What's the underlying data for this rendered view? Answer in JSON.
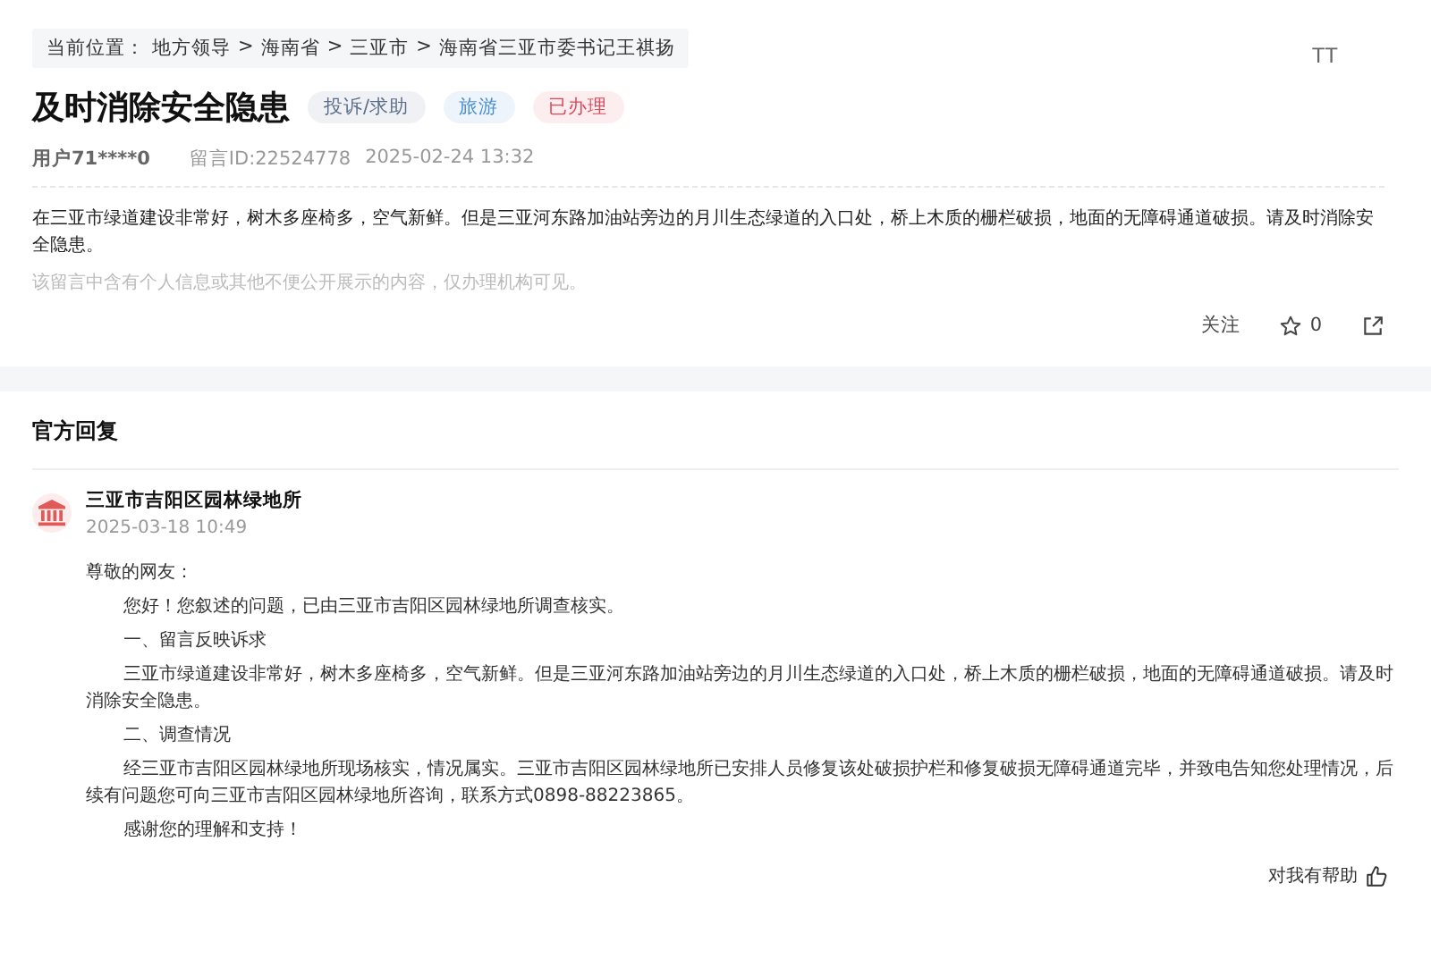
{
  "breadcrumb": {
    "label": "当前位置：",
    "items": [
      "地方领导",
      "海南省",
      "三亚市",
      "海南省三亚市委书记王祺扬"
    ],
    "separator": ">"
  },
  "font_size_button": "TT",
  "title": "及时消除安全隐患",
  "tags": [
    {
      "label": "投诉/求助",
      "color": "#5b6f8c"
    },
    {
      "label": "旅游",
      "color": "#4a8fd0"
    },
    {
      "label": "已办理",
      "color": "#e0475a"
    }
  ],
  "meta": {
    "user": "用户71****0",
    "message_id": "留言ID:22524778",
    "time": "2025-02-24 13:32"
  },
  "content": "在三亚市绿道建设非常好，树木多座椅多，空气新鲜。但是三亚河东路加油站旁边的月川生态绿道的入口处，桥上木质的栅栏破损，地面的无障碍通道破损。请及时消除安全隐患。",
  "privacy_note": "该留言中含有个人信息或其他不便公开展示的内容，仅办理机构可见。",
  "actions": {
    "follow": "关注",
    "likes": "0"
  },
  "reply": {
    "heading": "官方回复",
    "org": "三亚市吉阳区园林绿地所",
    "time": "2025-03-18 10:49",
    "paragraphs": [
      {
        "kind": "salutation",
        "text": "尊敬的网友："
      },
      {
        "kind": "indented",
        "text": "您好！您叙述的问题，已由三亚市吉阳区园林绿地所调查核实。"
      },
      {
        "kind": "indented",
        "text": "一、留言反映诉求"
      },
      {
        "kind": "indented",
        "text": "三亚市绿道建设非常好，树木多座椅多，空气新鲜。但是三亚河东路加油站旁边的月川生态绿道的入口处，桥上木质的栅栏破损，地面的无障碍通道破损。请及时消除安全隐患。"
      },
      {
        "kind": "indented",
        "text": "二、调查情况"
      },
      {
        "kind": "indented",
        "text": "经三亚市吉阳区园林绿地所现场核实，情况属实。三亚市吉阳区园林绿地所已安排人员修复该处破损护栏和修复破损无障碍通道完毕，并致电告知您处理情况，后续有问题您可向三亚市吉阳区园林绿地所咨询，联系方式0898-88223865。"
      },
      {
        "kind": "indented",
        "text": "感谢您的理解和支持！"
      }
    ],
    "helpful": "对我有帮助"
  }
}
